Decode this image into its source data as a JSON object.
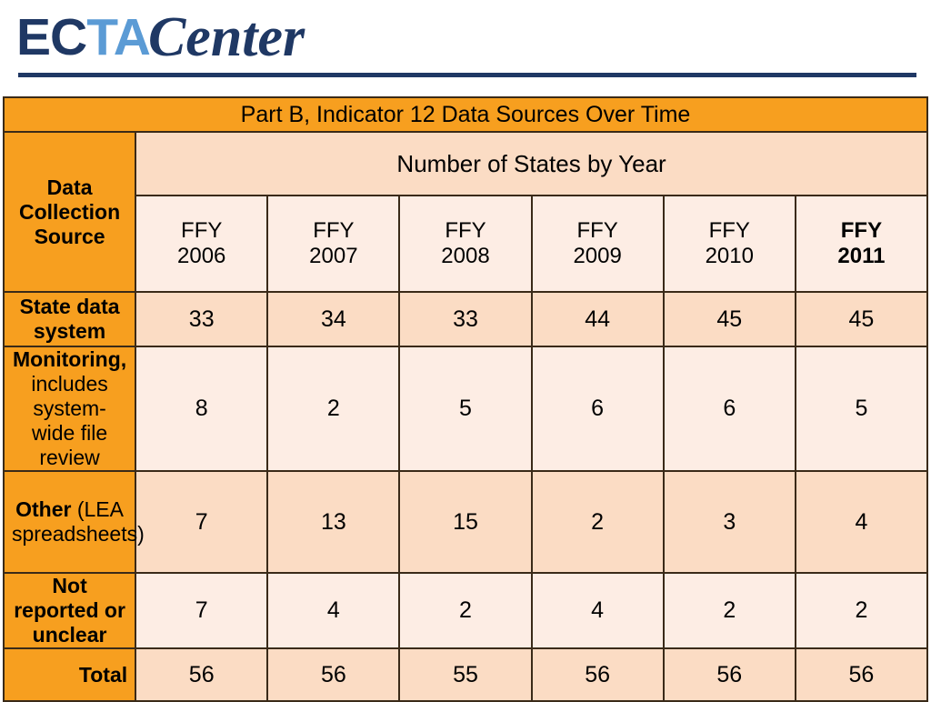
{
  "logo": {
    "part1": "EC",
    "part2": "TA",
    "part3": "Center"
  },
  "table": {
    "title": "Part B, Indicator 12 Data Sources Over Time",
    "row_header_label": "Data Collection Source",
    "span_header": "Number of States by Year",
    "columns": [
      {
        "line1": "FFY",
        "line2": "2006"
      },
      {
        "line1": "FFY",
        "line2": "2007"
      },
      {
        "line1": "FFY",
        "line2": "2008"
      },
      {
        "line1": "FFY",
        "line2": "2009"
      },
      {
        "line1": "FFY",
        "line2": "2010"
      },
      {
        "line1": "FFY",
        "line2": "2011"
      }
    ],
    "rows": [
      {
        "label_bold": "State data system",
        "label_rest": "",
        "values": [
          "33",
          "34",
          "33",
          "44",
          "45",
          "45"
        ]
      },
      {
        "label_bold": "Monitoring,",
        "label_rest": "includes system-wide file review",
        "values": [
          "8",
          "2",
          "5",
          "6",
          "6",
          "5"
        ]
      },
      {
        "label_bold": "Other",
        "label_rest": "(LEA spreadsheets)",
        "values": [
          "7",
          "13",
          "15",
          "2",
          "3",
          "4"
        ]
      },
      {
        "label_bold": "Not reported or unclear",
        "label_rest": "",
        "values": [
          "7",
          "4",
          "2",
          "4",
          "2",
          "2"
        ]
      }
    ],
    "total_label": "Total",
    "total_values": [
      "56",
      "56",
      "55",
      "56",
      "56",
      "56"
    ]
  },
  "colors": {
    "orange": "#F79F1F",
    "peach_dark": "#FBDCC4",
    "peach_light": "#FDEDE4",
    "navy": "#1F3864",
    "light_blue": "#5B9BD5",
    "border": "#3A2A18"
  }
}
